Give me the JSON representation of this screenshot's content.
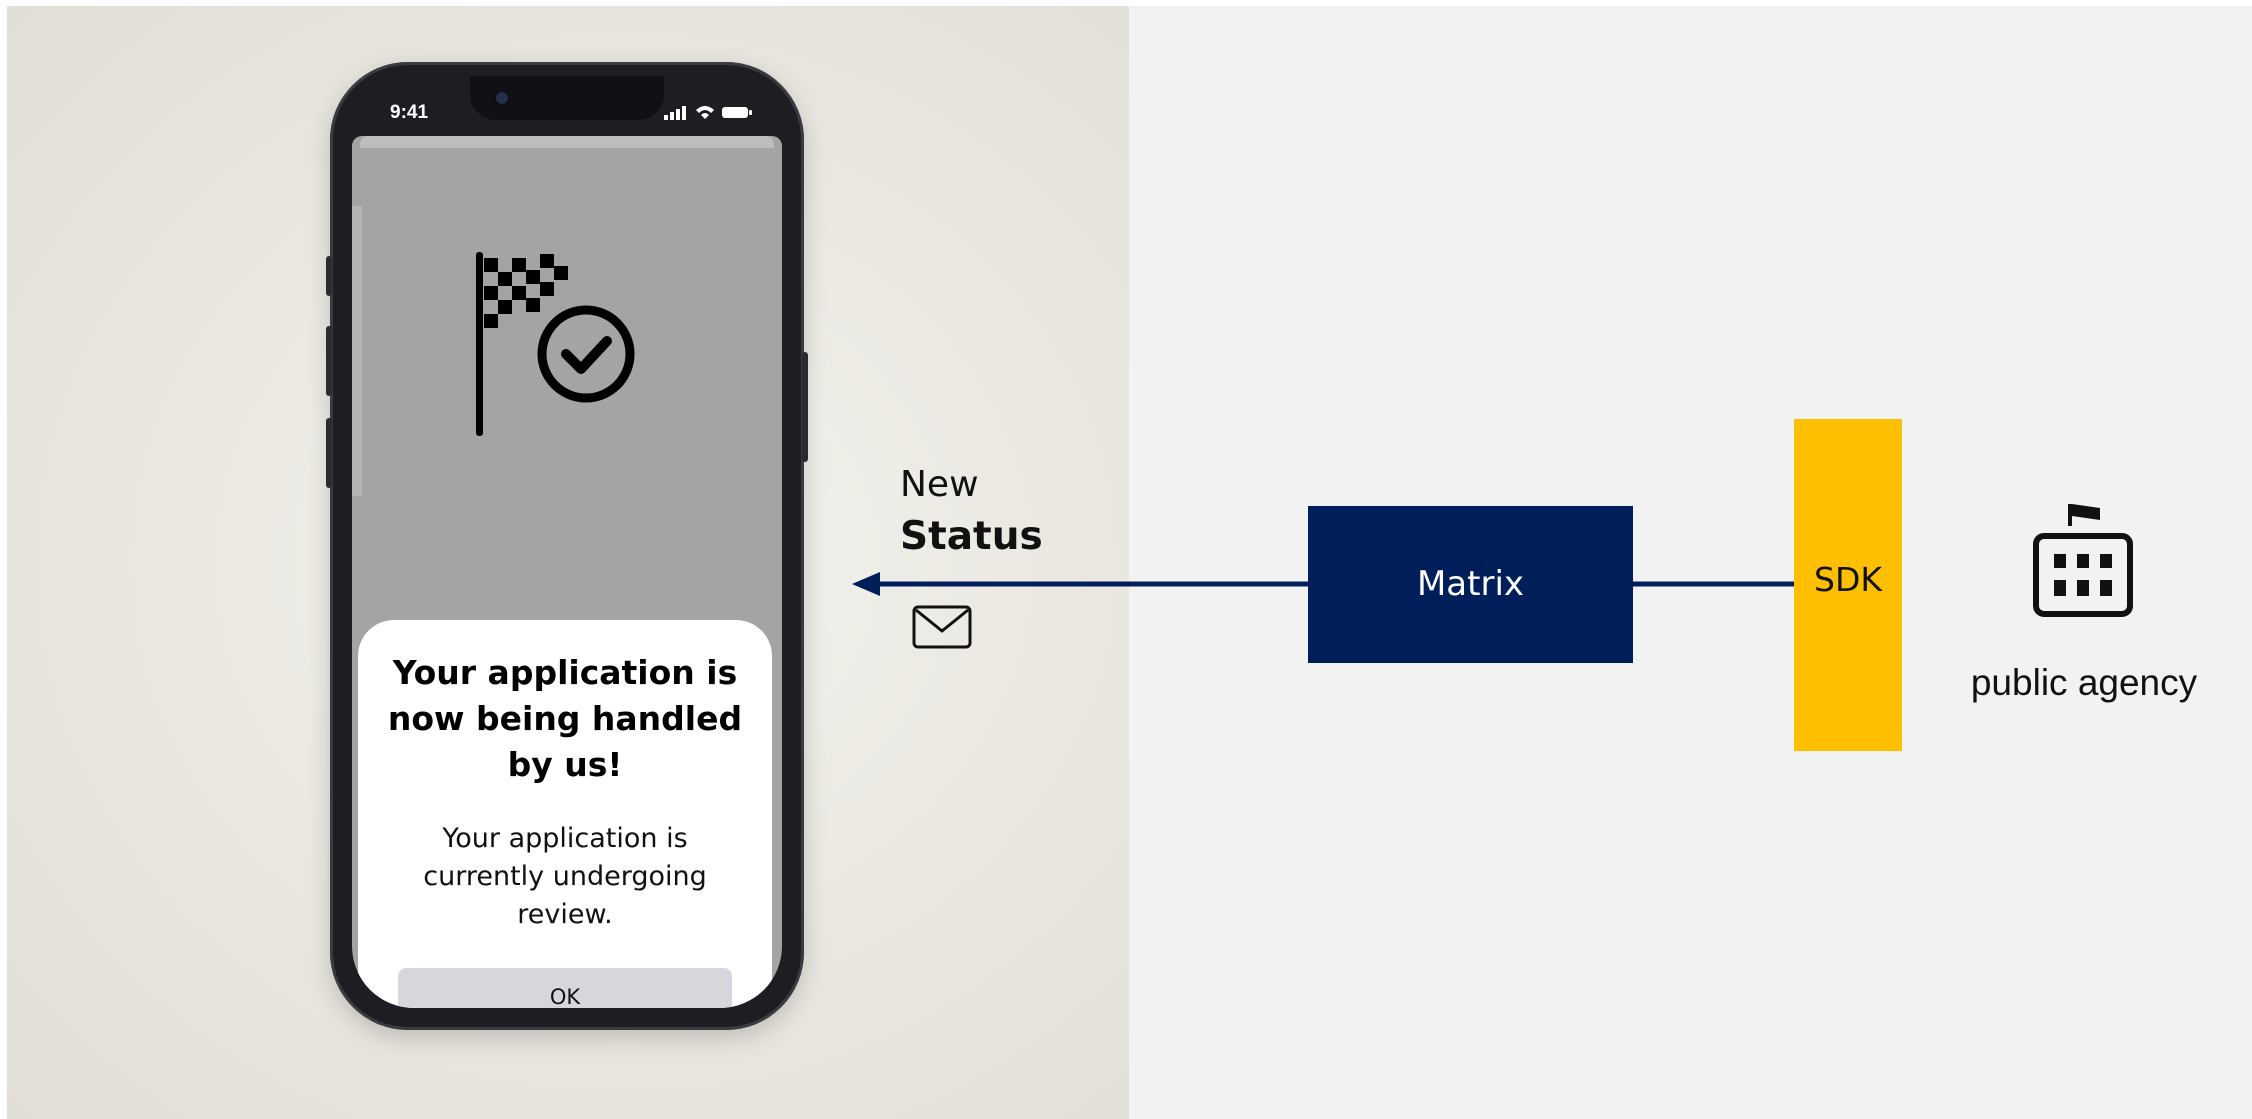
{
  "phone": {
    "status_time": "9:41",
    "dialog": {
      "title": "Your application is now being handled by us!",
      "body": "Your application is currently undergoing review.",
      "ok_label": "OK"
    }
  },
  "message": {
    "line1": "New",
    "line2": "Status",
    "icon": "envelope-icon"
  },
  "nodes": {
    "matrix_label": "Matrix",
    "sdk_label": "SDK",
    "agency_label": "public agency",
    "agency_icon": "building-with-flag-icon"
  },
  "colors": {
    "matrix": "#001e5a",
    "sdk": "#fdbf00",
    "arrow": "#001e5a",
    "right_background": "#f2f2f2"
  }
}
